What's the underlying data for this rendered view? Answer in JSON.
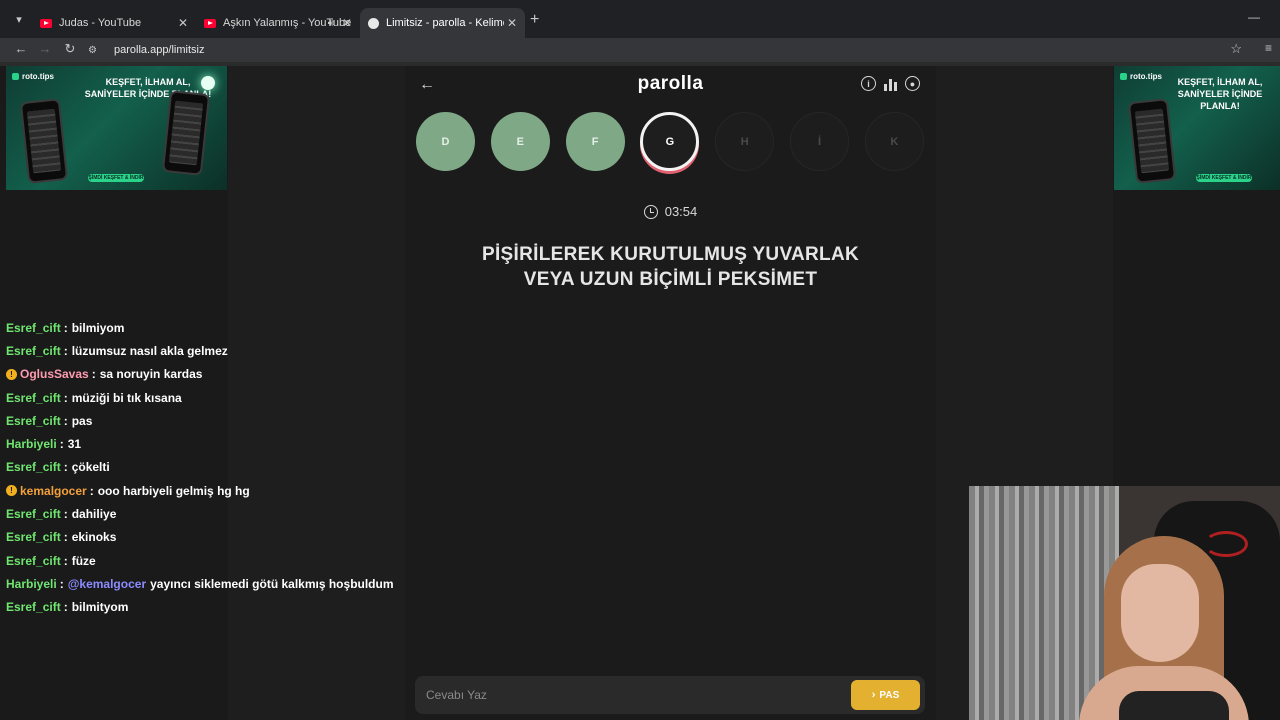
{
  "browser": {
    "tabs": [
      {
        "title": "Judas - YouTube",
        "icon": "youtube-icon"
      },
      {
        "title": "Aşkın Yalanmış - YouTube",
        "icon": "youtube-icon",
        "audio": true
      },
      {
        "title": "Limitsiz - parolla - Kelime oyun",
        "icon": "parolla-icon",
        "active": true
      }
    ],
    "new_tab": "+",
    "url": "parolla.app/limitsiz"
  },
  "ads": {
    "brand": "roto.tips",
    "headline_line1": "KEŞFET, İLHAM AL,",
    "headline_line2": "SANİYELER İÇİNDE PLANLA!",
    "cta": "ŞİMDİ KEŞFET & İNDİR"
  },
  "chat": [
    {
      "user": "Esref_cift",
      "color": "#6fe66f",
      "text": "bilmiyom"
    },
    {
      "user": "Esref_cift",
      "color": "#6fe66f",
      "text": "lüzumsuz nasıl akla gelmez"
    },
    {
      "user": "OglusSavas",
      "color": "#ff9bb0",
      "badge": true,
      "text": "sa noruyin kardas"
    },
    {
      "user": "Esref_cift",
      "color": "#6fe66f",
      "text": "müziği bi tık kısana"
    },
    {
      "user": "Esref_cift",
      "color": "#6fe66f",
      "text": "pas"
    },
    {
      "user": "Harbiyeli",
      "color": "#6fe66f",
      "text": "31"
    },
    {
      "user": "Esref_cift",
      "color": "#6fe66f",
      "text": "çökelti"
    },
    {
      "user": "kemalgocer",
      "color": "#f2a13a",
      "badge": true,
      "text": "ooo harbiyeli gelmiş hg hg"
    },
    {
      "user": "Esref_cift",
      "color": "#6fe66f",
      "text": "dahiliye"
    },
    {
      "user": "Esref_cift",
      "color": "#6fe66f",
      "text": "ekinoks"
    },
    {
      "user": "Esref_cift",
      "color": "#6fe66f",
      "text": "füze"
    },
    {
      "user": "Harbiyeli",
      "color": "#6fe66f",
      "mention": "@kemalgocer",
      "text": "yayıncı siklemedi götü kalkmış hoşbuldum"
    },
    {
      "user": "Esref_cift",
      "color": "#6fe66f",
      "text": "bilmityom"
    }
  ],
  "game": {
    "title": "parolla",
    "letters": [
      {
        "letter": "D",
        "state": "done"
      },
      {
        "letter": "E",
        "state": "done"
      },
      {
        "letter": "F",
        "state": "done"
      },
      {
        "letter": "G",
        "state": "active"
      },
      {
        "letter": "H",
        "state": "pending"
      },
      {
        "letter": "İ",
        "state": "pending"
      },
      {
        "letter": "K",
        "state": "pending"
      }
    ],
    "timer": "03:54",
    "question_line1": "PİŞİRİLEREK KURUTULMUŞ YUVARLAK",
    "question_line2": "VEYA UZUN BİÇİMLİ PEKSİMET",
    "answer_placeholder": "Cevabı Yaz",
    "pass_label": "PAS"
  }
}
